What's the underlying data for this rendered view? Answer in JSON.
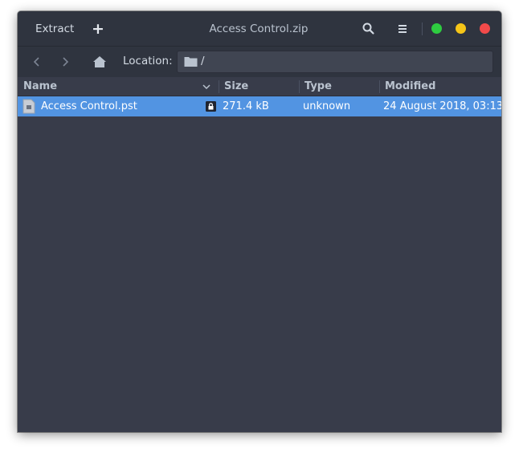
{
  "header": {
    "extract_label": "Extract",
    "add_label": "+",
    "title": "Access Control.zip",
    "search_icon": "search-icon",
    "menu_icon": "hamburger-menu-icon",
    "window_buttons": {
      "maximize_color": "#2ecc40",
      "minimize_color": "#f5c518",
      "close_color": "#f24a4a"
    }
  },
  "toolbar": {
    "back_icon": "chevron-left-icon",
    "forward_icon": "chevron-right-icon",
    "home_icon": "home-icon",
    "location_label": "Location:",
    "location_value": "/",
    "folder_icon": "folder-icon"
  },
  "columns": {
    "name": "Name",
    "size": "Size",
    "type": "Type",
    "modified": "Modified"
  },
  "files": [
    {
      "name": "Access Control.pst",
      "encrypted": true,
      "size": "271.4 kB",
      "type": "unknown",
      "modified": "24 August 2018, 03:13",
      "selected": true
    }
  ],
  "colors": {
    "window_bg": "#383c4a",
    "headerbar_bg": "#2f343f",
    "selection": "#5294e2",
    "text": "#d3dae3"
  }
}
